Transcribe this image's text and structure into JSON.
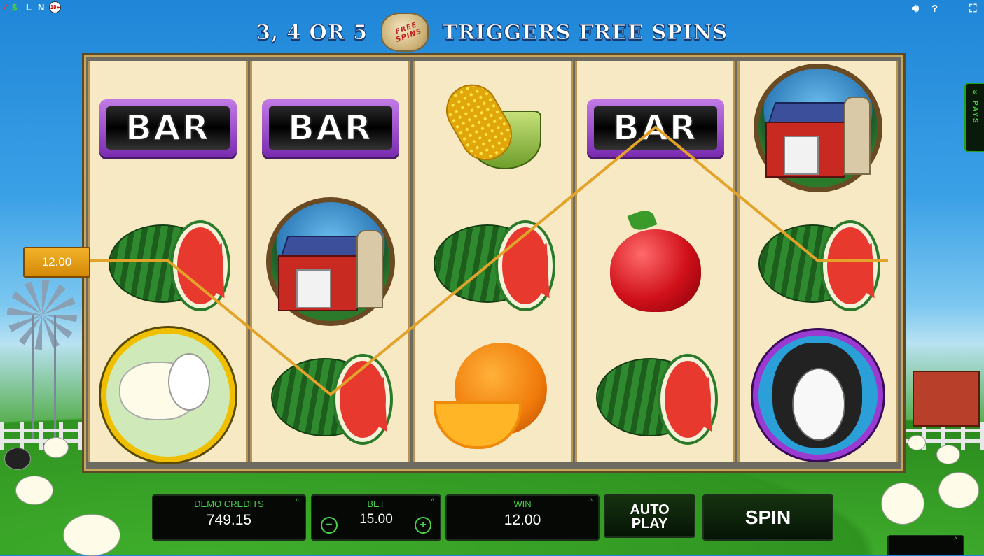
{
  "topbar": {
    "license_icons": [
      "check-icon",
      "dollar-icon",
      "L",
      "N"
    ],
    "age_badge": "18+",
    "sound_icon": "speaker-icon",
    "help_label": "?",
    "fullscreen_icon": "fullscreen-icon"
  },
  "banner": {
    "left_text": "3, 4 OR 5",
    "bag_text": "FREE SPINS",
    "right_text": "TRIGGERS FREE SPINS"
  },
  "reels": [
    [
      "bar",
      "watermelon",
      "white-sheep"
    ],
    [
      "bar",
      "barn",
      "watermelon"
    ],
    [
      "corn",
      "watermelon",
      "orange"
    ],
    [
      "bar",
      "apple",
      "watermelon"
    ],
    [
      "barn",
      "watermelon",
      "black-sheep"
    ]
  ],
  "bar_label": "BAR",
  "win_line": {
    "amount": "12.00",
    "color": "#e3a32a",
    "rows": [
      1,
      2,
      1,
      0,
      1
    ]
  },
  "pays_tab": {
    "chevron": "«",
    "label": "PAYS"
  },
  "controls": {
    "credits_label": "DEMO CREDITS",
    "credits_value": "749.15",
    "bet_label": "BET",
    "bet_value": "15.00",
    "bet_minus": "−",
    "bet_plus": "+",
    "win_label": "WIN",
    "win_value": "12.00",
    "autoplay_label_1": "AUTO",
    "autoplay_label_2": "PLAY",
    "spin_label": "SPIN",
    "expand_icon": "chevron-up-icon",
    "expand_symbol": "^"
  },
  "colors": {
    "accent_green": "#49d049",
    "bar_purple": "#9a3ad0",
    "reel_bg": "#f6e9c4"
  }
}
